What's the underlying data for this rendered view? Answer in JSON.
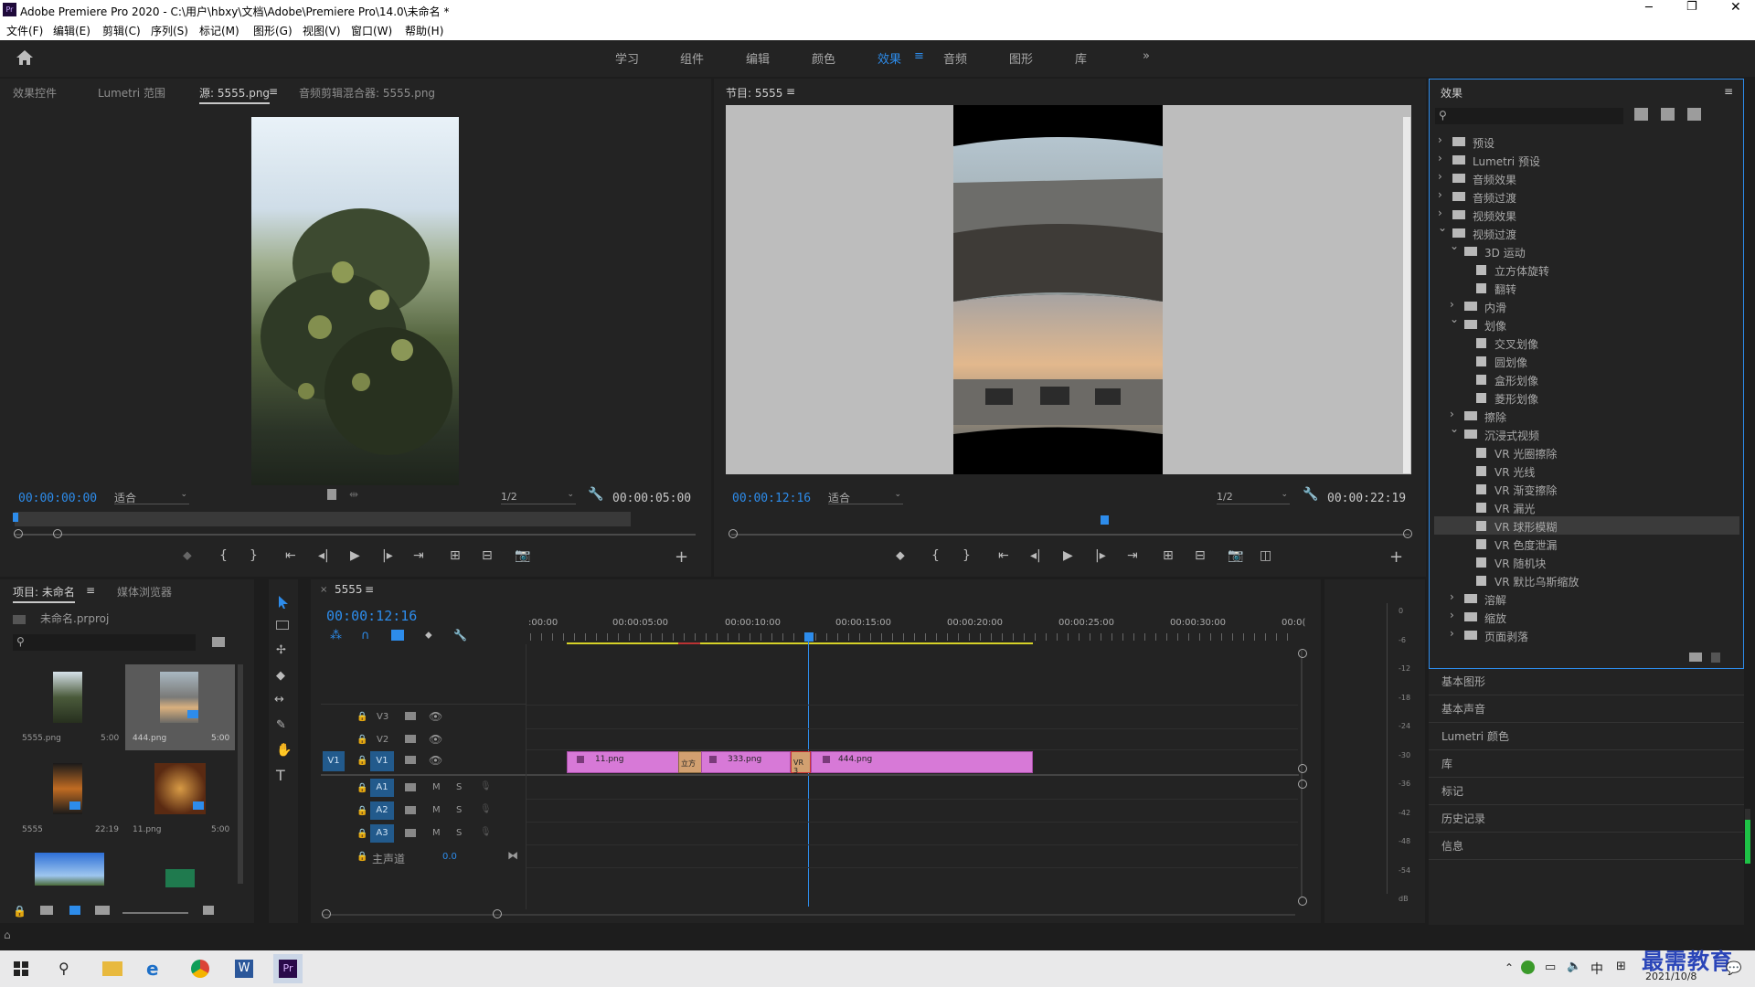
{
  "window": {
    "title": "Adobe Premiere Pro 2020 - C:\\用户\\hbxy\\文档\\Adobe\\Premiere Pro\\14.0\\未命名 *"
  },
  "menu": [
    "文件(F)",
    "编辑(E)",
    "剪辑(C)",
    "序列(S)",
    "标记(M)",
    "图形(G)",
    "视图(V)",
    "窗口(W)",
    "帮助(H)"
  ],
  "workspaces": [
    "学习",
    "组件",
    "编辑",
    "颜色",
    "效果",
    "音频",
    "图形",
    "库"
  ],
  "active_workspace": "效果",
  "source_panel": {
    "tabs": [
      "效果控件",
      "Lumetri 范围",
      "源: 5555.png",
      "音频剪辑混合器: 5555.png"
    ],
    "timecode": "00:00:00:00",
    "fit": "适合",
    "resolution": "1/2",
    "duration": "00:00:05:00"
  },
  "program_panel": {
    "tab": "节目: 5555",
    "timecode": "00:00:12:16",
    "fit": "适合",
    "resolution": "1/2",
    "duration": "00:00:22:19"
  },
  "effects_panel": {
    "title": "效果",
    "tree": [
      {
        "label": "预设",
        "level": 0,
        "type": "folder",
        "state": "closed"
      },
      {
        "label": "Lumetri 预设",
        "level": 0,
        "type": "folder",
        "state": "closed"
      },
      {
        "label": "音频效果",
        "level": 0,
        "type": "folder",
        "state": "closed"
      },
      {
        "label": "音频过渡",
        "level": 0,
        "type": "folder",
        "state": "closed"
      },
      {
        "label": "视频效果",
        "level": 0,
        "type": "folder",
        "state": "closed"
      },
      {
        "label": "视频过渡",
        "level": 0,
        "type": "folder",
        "state": "open"
      },
      {
        "label": "3D 运动",
        "level": 1,
        "type": "folder",
        "state": "open"
      },
      {
        "label": "立方体旋转",
        "level": 2,
        "type": "item"
      },
      {
        "label": "翻转",
        "level": 2,
        "type": "item"
      },
      {
        "label": "内滑",
        "level": 1,
        "type": "folder",
        "state": "closed"
      },
      {
        "label": "划像",
        "level": 1,
        "type": "folder",
        "state": "open"
      },
      {
        "label": "交叉划像",
        "level": 2,
        "type": "item"
      },
      {
        "label": "圆划像",
        "level": 2,
        "type": "item"
      },
      {
        "label": "盒形划像",
        "level": 2,
        "type": "item"
      },
      {
        "label": "菱形划像",
        "level": 2,
        "type": "item"
      },
      {
        "label": "擦除",
        "level": 1,
        "type": "folder",
        "state": "closed"
      },
      {
        "label": "沉浸式视频",
        "level": 1,
        "type": "folder",
        "state": "open"
      },
      {
        "label": "VR 光圈擦除",
        "level": 2,
        "type": "item"
      },
      {
        "label": "VR 光线",
        "level": 2,
        "type": "item"
      },
      {
        "label": "VR 渐变擦除",
        "level": 2,
        "type": "item"
      },
      {
        "label": "VR 漏光",
        "level": 2,
        "type": "item"
      },
      {
        "label": "VR 球形模糊",
        "level": 2,
        "type": "item",
        "selected": true
      },
      {
        "label": "VR 色度泄漏",
        "level": 2,
        "type": "item"
      },
      {
        "label": "VR 随机块",
        "level": 2,
        "type": "item"
      },
      {
        "label": "VR 默比乌斯缩放",
        "level": 2,
        "type": "item"
      },
      {
        "label": "溶解",
        "level": 1,
        "type": "folder",
        "state": "closed"
      },
      {
        "label": "缩放",
        "level": 1,
        "type": "folder",
        "state": "closed"
      },
      {
        "label": "页面剥落",
        "level": 1,
        "type": "folder",
        "state": "closed"
      }
    ]
  },
  "side_panels": [
    "基本图形",
    "基本声音",
    "Lumetri 颜色",
    "库",
    "标记",
    "历史记录",
    "信息"
  ],
  "project_panel": {
    "tabs": [
      "项目: 未命名",
      "媒体浏览器"
    ],
    "file": "未命名.prproj",
    "items": [
      {
        "name": "5555.png",
        "dur": "5:00"
      },
      {
        "name": "444.png",
        "dur": "5:00"
      },
      {
        "name": "5555",
        "dur": "22:19"
      },
      {
        "name": "11.png",
        "dur": "5:00"
      }
    ]
  },
  "timeline": {
    "tab": "5555",
    "timecode": "00:00:12:16",
    "ruler": [
      ":00:00",
      "00:00:05:00",
      "00:00:10:00",
      "00:00:15:00",
      "00:00:20:00",
      "00:00:25:00",
      "00:00:30:00",
      "00:0("
    ],
    "video_tracks": [
      "V3",
      "V2",
      "V1"
    ],
    "audio_tracks": [
      "A1",
      "A2",
      "A3"
    ],
    "source_v": "V1",
    "master": "主声道",
    "master_val": "0.0",
    "clips": [
      {
        "name": "11.png"
      },
      {
        "name": "立方"
      },
      {
        "name": "333.png"
      },
      {
        "name": "VR 3"
      },
      {
        "name": "444.png"
      }
    ],
    "ms": [
      "M",
      "S"
    ]
  },
  "meter": [
    "0",
    "-6",
    "-12",
    "-18",
    "-24",
    "-30",
    "-36",
    "-42",
    "-48",
    "-54",
    "dB"
  ],
  "taskbar": {
    "ime": "中",
    "date": "2021/10/8",
    "watermark": "最需教育"
  },
  "colors": {
    "accent": "#2d8ceb",
    "clip": "#d779d7",
    "playhead": "#2d8ceb",
    "selected_row": "#3b3b3b"
  }
}
